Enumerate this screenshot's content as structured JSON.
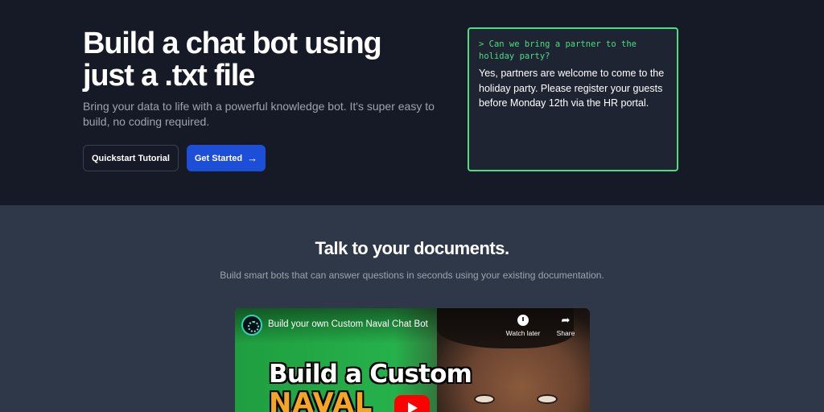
{
  "hero": {
    "title": "Build a chat bot using just a .txt file",
    "subtitle": "Bring your data to life with a powerful knowledge bot. It's super easy to build, no coding required.",
    "tutorial_label": "Quickstart Tutorial",
    "start_label": "Get Started",
    "start_icon": "arrow-right-icon",
    "accent_color": "#1d4ed8"
  },
  "terminal": {
    "prompt": "> Can we bring a partner to the holiday party?",
    "answer": "Yes, partners are welcome to come to the holiday party. Please register your guests before Monday 12th via the HR portal.",
    "border_color": "#4ade80"
  },
  "section": {
    "title": "Talk to your documents.",
    "subtitle": "Build smart bots that can answer questions in seconds using your existing documentation."
  },
  "video": {
    "title": "Build your own Custom Naval Chat Bot",
    "watch_later_label": "Watch later",
    "share_label": "Share",
    "thumb_line1": "Build a Custom",
    "thumb_line2": "NAVAL"
  }
}
